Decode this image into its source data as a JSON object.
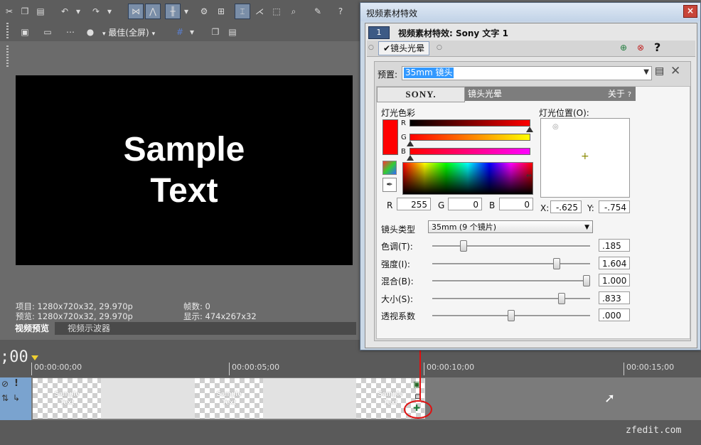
{
  "preview": {
    "sample_line1": "Sample",
    "sample_line2": "Text",
    "toolbar2_quality": "最佳(全屏)",
    "project_label": "项目: 1280x720x32, 29.970p",
    "preview_label": "预览: 1280x720x32, 29.970p",
    "frames_label": "帧数: 0",
    "display_label": "显示: 474x267x32",
    "tabs": [
      "视频预览",
      "视频示波器"
    ]
  },
  "timeline": {
    "time_display": ";00",
    "ruler": [
      "00:00:00;00",
      "00:00:05;00",
      "00:00:10;00",
      "00:00:15;00"
    ],
    "clip_thumb_line1": "Sample",
    "clip_thumb_line2": "Text"
  },
  "dialog": {
    "title": "视频素材特效",
    "chain_number": "1",
    "chain_title": "视频素材特效: Sony 文字 1",
    "plugin_name": "镜头光晕",
    "help_glyph": "?",
    "preset_label": "预置:",
    "preset_value": "35mm 镜头",
    "sony_brand": "SONY.",
    "plugin_header": "镜头光晕",
    "about_label": "关于",
    "about_help": "?",
    "light_color_label": "灯光色彩",
    "light_position_label": "灯光位置(O):",
    "rgb": {
      "r_label": "R",
      "r": "255",
      "g_label": "G",
      "g": "0",
      "b_label": "B",
      "b": "0"
    },
    "channel_labels": [
      "R",
      "G",
      "B"
    ],
    "pos": {
      "x_label": "X:",
      "x": "-.625",
      "y_label": "Y:",
      "y": "-.754"
    },
    "lens_type_label": "镜头类型",
    "lens_type_value": "35mm (9 个镜片)",
    "sliders": [
      {
        "label": "色调(T):",
        "value": ".185",
        "level": 0.185
      },
      {
        "label": "强度(I):",
        "value": "1.604",
        "level": 0.8
      },
      {
        "label": "混合(B):",
        "value": "1.000",
        "level": 1.0
      },
      {
        "label": "大小(S):",
        "value": ".833",
        "level": 0.833
      },
      {
        "label": "透视系数",
        "value": ".000",
        "level": 0.5
      }
    ],
    "colors": {
      "light_color": "#ff0000",
      "accent_selection": "#3399ff"
    }
  },
  "watermark": "zfedit.com"
}
